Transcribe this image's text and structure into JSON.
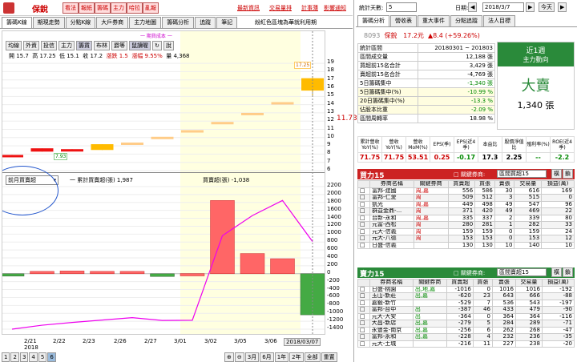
{
  "topbar": {
    "buttons": [
      "看法",
      "報紙",
      "籌碼",
      "主力",
      "哈拉",
      "亂報"
    ],
    "stock_name": "保銳",
    "right_links": [
      "最新資訊",
      "交易量排",
      "計事薄",
      "影響通知"
    ]
  },
  "left_tabs": [
    "籌碼K線",
    "期現走勢",
    "分點K線",
    "大戶券商",
    "主力地圖",
    "籌碼分析",
    "追蹤",
    "筆記"
  ],
  "note_right": "紛紅色區塊為華就利用期",
  "period_hint": "一 期貨成本 一",
  "chart_toolbar": [
    "均線",
    "外資",
    "投信",
    "主力",
    "籌貨",
    "布林",
    "爵等",
    "鼠讀喔",
    "↻",
    "說"
  ],
  "ohlc": {
    "open": "開 15.7",
    "high": "高 17.25",
    "low": "低 15.1",
    "close": "收 17.2",
    "chg": "漲跌 1.5",
    "pct": "漲幅 9.55%",
    "vol": "量 4,368"
  },
  "price_labels": {
    "high": "17.25",
    "low": "7.93",
    "cur": "11.73"
  },
  "chart_data": [
    {
      "type": "bar",
      "title": "",
      "y_ticks": [
        "19",
        "18",
        "17",
        "16",
        "15",
        "14",
        "13",
        "12",
        "11",
        "10",
        "9",
        "8",
        "7",
        "6"
      ],
      "ylim": [
        6,
        19.4
      ],
      "candles": [
        {
          "x": "2/20",
          "o": 7.9,
          "c": 7.7,
          "h": 7.9,
          "l": 7.7
        },
        {
          "x": "2/21",
          "o": 8.7,
          "c": 8.3,
          "h": 8.7,
          "l": 8.3
        },
        {
          "x": "2/22",
          "o": 8.6,
          "c": 8.4,
          "h": 8.6,
          "l": 8.4
        },
        {
          "x": "2/23",
          "o": 8.5,
          "c": 9.2,
          "h": 9.2,
          "l": 8.5
        },
        {
          "x": "2/26",
          "o": 9.4,
          "c": 9.4,
          "h": 9.4,
          "l": 9.4
        },
        {
          "x": "2/27",
          "o": 10.1,
          "c": 10.1,
          "h": 10.1,
          "l": 10.1
        },
        {
          "x": "3/01",
          "o": 10.9,
          "c": 10.9,
          "h": 10.9,
          "l": 10.9
        },
        {
          "x": "3/02",
          "o": 11.9,
          "c": 11.9,
          "h": 11.9,
          "l": 11.9
        },
        {
          "x": "3/05",
          "o": 13.0,
          "c": 13.0,
          "h": 13.0,
          "l": 13.0
        },
        {
          "x": "3/06",
          "o": 14.3,
          "c": 14.3,
          "h": 14.3,
          "l": 14.3
        },
        {
          "x": "3/07",
          "o": 15.7,
          "c": 17.2,
          "h": 17.25,
          "l": 15.1
        }
      ]
    },
    {
      "type": "bar",
      "legend": [
        "一 累計買賣超(張) 1,987",
        "買賣超(張) -1,038"
      ],
      "y_ticks": [
        "2200",
        "2000",
        "1800",
        "1600",
        "1400",
        "1200",
        "1000",
        "800",
        "600",
        "400",
        "200",
        "0",
        "-200",
        "-400",
        "-600",
        "-800",
        "-1000",
        "-1200",
        "-1400"
      ],
      "ylim": [
        -1400,
        2200
      ],
      "categories": [
        "2/20",
        "2/21",
        "2/22",
        "2/23",
        "2/26",
        "2/27",
        "3/01",
        "3/02",
        "3/05",
        "3/06",
        "3/07"
      ],
      "values": [
        -20,
        60,
        70,
        60,
        60,
        -70,
        5,
        1850,
        510,
        380,
        -1038
      ],
      "cumulative": [
        -1400,
        -1300,
        -1230,
        -1170,
        -1110,
        -1180,
        -1175,
        960,
        1470,
        1850,
        812
      ]
    }
  ],
  "x_labels": [
    "2/21",
    "2/22",
    "2/23",
    "2/26",
    "2/27",
    "3/01",
    "3/02",
    "3/05",
    "3/06",
    "2018/03/07"
  ],
  "x_year": "2018",
  "dropdown": {
    "value": "前月買賣超"
  },
  "bottom_pager": [
    "1",
    "2",
    "3",
    "4",
    "5",
    "6"
  ],
  "bottom_range": [
    "3月",
    "6月",
    "1年",
    "2年",
    "全部",
    "重置"
  ],
  "right": {
    "days_label": "統計天數:",
    "days_value": "5",
    "date_label": "日期:",
    "date_value": "2018/3/7",
    "today_btn": "今天",
    "tabs": [
      "籌碼分析",
      "營收表",
      "重大事件",
      "分點追蹤",
      "法人目標"
    ],
    "stock_code": "8093",
    "stock_name": "保銳",
    "price": "17.2元",
    "change": "▲8.4 (+59.26%)",
    "stats": [
      [
        "統計區間",
        "20180301 ~ 201803"
      ],
      [
        "區間成交量",
        "12,188 張"
      ],
      [
        "買超前15名合計",
        "3,429 張"
      ],
      [
        "賣超前15名合計",
        "-4,769 張"
      ],
      [
        "5日籌碼集中",
        "-1,340 張"
      ],
      [
        "5日籌碼集中(%)",
        "-10.99 %"
      ],
      [
        "20日籌碼集中(%)",
        "-13.3 %"
      ],
      [
        "佔股本比重",
        "-2.09 %"
      ],
      [
        "區間周轉率",
        "18.98 %"
      ]
    ],
    "green_box": {
      "title1": "近1週",
      "title2": "主力動向",
      "big": "大賣",
      "amount": "1,340 張"
    },
    "rev_headers": [
      "累計營收YoY(%)",
      "營收YoY(%)",
      "營收MoM(%)",
      "EPS(季)",
      "EPS(近4季)",
      "本益比",
      "股價淨值比",
      "殖利率(%)",
      "ROE(近4季)"
    ],
    "rev_values": [
      "71.75",
      "71.75",
      "53.51",
      "0.25",
      "-0.17",
      "17.3",
      "2.25",
      "--",
      "-2.2"
    ],
    "buy_title": "買力15",
    "buy_filter": "□ 關鍵券商:",
    "buy_select": "區間買超15",
    "buy_btns": [
      "橫",
      "鎖"
    ],
    "cols": [
      "券商名稱",
      "關鍵券商",
      "買賣超",
      "買張",
      "賣張",
      "交易量",
      "損益(萬)"
    ],
    "buy_rows": [
      [
        "富邦-建國",
        "周,嘉",
        "556",
        "586",
        "30",
        "616",
        "169"
      ],
      [
        "富邦-仁愛",
        "周",
        "509",
        "512",
        "3",
        "515",
        "0"
      ],
      [
        "凱光",
        "周,嘉",
        "449",
        "498",
        "49",
        "547",
        "96"
      ],
      [
        "群益金鼎-...",
        "周",
        "371",
        "420",
        "49",
        "469",
        "22"
      ],
      [
        "台新-永和",
        "周,嘉",
        "335",
        "337",
        "2",
        "339",
        "80"
      ],
      [
        "元富-西松",
        "周",
        "280",
        "281",
        "1",
        "282",
        "33"
      ],
      [
        "元大-信義",
        "周",
        "159",
        "159",
        "0",
        "159",
        "24"
      ],
      [
        "元大-八德",
        "周",
        "153",
        "153",
        "0",
        "153",
        "12"
      ],
      [
        "日盛-信義",
        "",
        "130",
        "130",
        "10",
        "140",
        "10"
      ]
    ],
    "sell_title": "賣力15",
    "sell_filter": "□ 關鍵券商:",
    "sell_select": "區間賣超15",
    "sell_btns": [
      "橫",
      "鎖"
    ],
    "sell_rows": [
      [
        "日盛-桃園",
        "出,地,嘉",
        "-1016",
        "0",
        "1016",
        "1016",
        "-192"
      ],
      [
        "玉山-新莊",
        "出,嘉",
        "-620",
        "23",
        "643",
        "666",
        "-88"
      ],
      [
        "嘉鍛-新竹",
        "",
        "-529",
        "7",
        "536",
        "543",
        "-197"
      ],
      [
        "富邦-台中",
        "出",
        "-387",
        "46",
        "433",
        "479",
        "-90"
      ],
      [
        "元大-大安",
        "出",
        "-364",
        "0",
        "364",
        "364",
        "-116"
      ],
      [
        "大昌-新店",
        "出,嘉",
        "-279",
        "5",
        "284",
        "289",
        "-71"
      ],
      [
        "永豐金-南京",
        "出,嘉",
        "-256",
        "6",
        "262",
        "268",
        "-47"
      ],
      [
        "富邦-永和",
        "出,嘉",
        "-228",
        "4",
        "232",
        "236",
        "-35"
      ],
      [
        "元大-土城",
        "",
        "-216",
        "11",
        "227",
        "238",
        "-20"
      ]
    ]
  }
}
